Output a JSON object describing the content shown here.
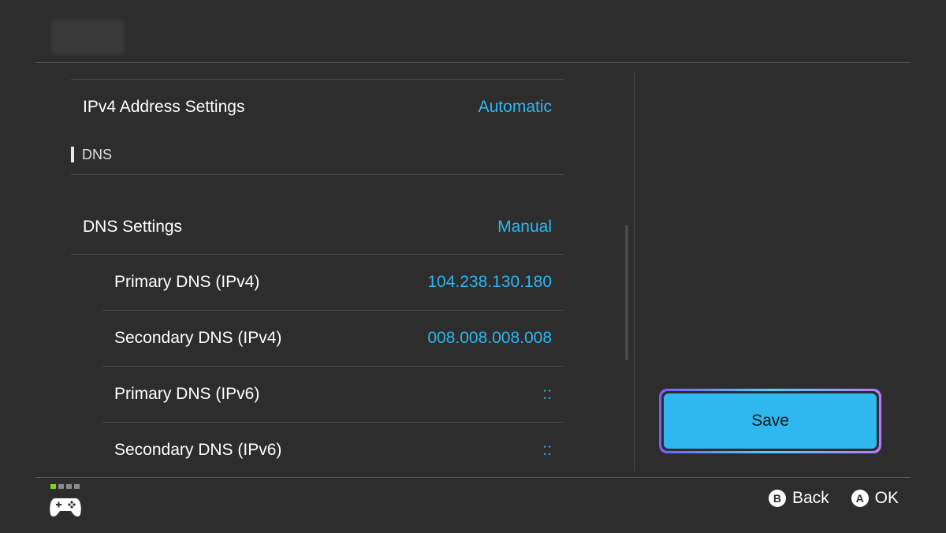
{
  "rows": {
    "ipv4": {
      "label": "IPv4 Address Settings",
      "value": "Automatic"
    },
    "section_dns": "DNS",
    "dns_settings": {
      "label": "DNS Settings",
      "value": "Manual"
    },
    "primary_ipv4": {
      "label": "Primary DNS (IPv4)",
      "value": "104.238.130.180"
    },
    "secondary_ipv4": {
      "label": "Secondary DNS (IPv4)",
      "value": "008.008.008.008"
    },
    "primary_ipv6": {
      "label": "Primary DNS (IPv6)",
      "value": "::"
    },
    "secondary_ipv6": {
      "label": "Secondary DNS (IPv6)",
      "value": "::"
    }
  },
  "save_label": "Save",
  "footer": {
    "back_key": "B",
    "back_label": "Back",
    "ok_key": "A",
    "ok_label": "OK"
  },
  "controller_icon": "gamepad-icon",
  "colors": {
    "accent": "#2fb7f0",
    "background": "#2d2d2d",
    "indicator_active": "#7ed321"
  }
}
